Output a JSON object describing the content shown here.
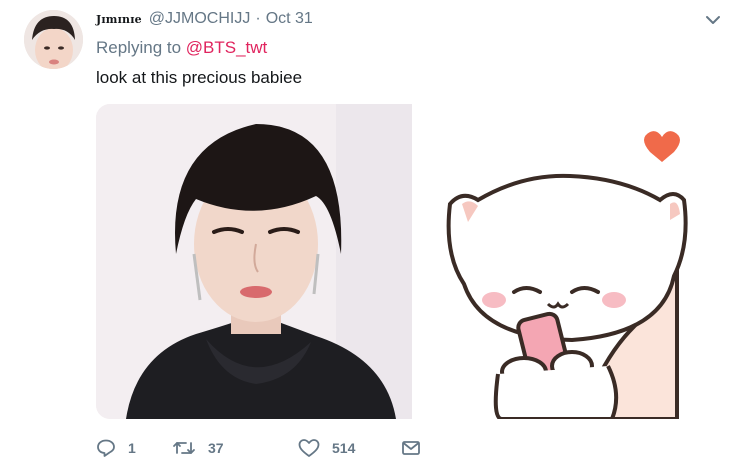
{
  "tweet": {
    "display_name": "Jɪmɪnɪe",
    "handle": "@JJMOCHIJJ",
    "separator": "·",
    "time": "Oct 31",
    "replying_to_prefix": "Replying to ",
    "replying_to_mention": "@BTS_twt",
    "text": "look at this precious babiee"
  },
  "actions": {
    "reply_count": "1",
    "retweet_count": "37",
    "like_count": "514"
  },
  "icons": {
    "more": "chevron-down-icon",
    "reply": "reply-bubble-icon",
    "retweet": "retweet-arrows-icon",
    "like": "heart-icon",
    "dm": "envelope-icon"
  },
  "colors": {
    "text_secondary": "#657786",
    "mention": "#e0245e",
    "text_primary": "#14171a"
  }
}
